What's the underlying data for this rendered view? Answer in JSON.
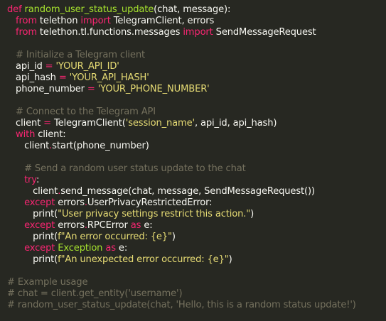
{
  "colors": {
    "background": "#272822",
    "default_text": "#f8f8f2",
    "keyword": "#f92672",
    "function_name": "#a6e22e",
    "string": "#e6db74",
    "comment": "#75715e"
  },
  "code": {
    "l1": {
      "kw": "def",
      "fn": "random_user_status_update",
      "rest": "(chat, message):"
    },
    "l2": {
      "kw1": "from",
      "mod": " telethon ",
      "kw2": "import",
      "rest": " TelegramClient, errors"
    },
    "l3": {
      "kw1": "from",
      "mod": " telethon.tl.functions.messages ",
      "kw2": "import",
      "rest": " SendMessageRequest"
    },
    "l5": {
      "comment": "# Initialize a Telegram client"
    },
    "l6": {
      "var": "api_id",
      "op": " = ",
      "str": "'YOUR_API_ID'"
    },
    "l7": {
      "var": "api_hash",
      "op": " = ",
      "str": "'YOUR_API_HASH'"
    },
    "l8": {
      "var": "phone_number",
      "op": " = ",
      "str": "'YOUR_PHONE_NUMBER'"
    },
    "l10": {
      "comment": "# Connect to the Telegram API"
    },
    "l11": {
      "var": "client",
      "op": " = ",
      "pre": "TelegramClient(",
      "str": "'session_name'",
      "rest": ", api_id, api_hash)"
    },
    "l12": {
      "kw": "with",
      "rest": " client:"
    },
    "l13": {
      "pre": "client",
      "op": ".",
      "rest": "start(phone_number)"
    },
    "l15": {
      "comment": "# Send a random user status update to the chat"
    },
    "l16": {
      "kw": "try",
      "rest": ":"
    },
    "l17": {
      "pre": "client",
      "op": ".",
      "rest": "send_message(chat, message, SendMessageRequest())"
    },
    "l18": {
      "kw": "except",
      "pre": " errors",
      "op": ".",
      "rest": "UserPrivacyRestrictedError:"
    },
    "l19": {
      "pre": "print(",
      "str": "\"User privacy settings restrict this action.\"",
      "rest": ")"
    },
    "l20": {
      "kw": "except",
      "pre": " errors",
      "op": ".",
      "mid": "RPCError ",
      "kw2": "as",
      "rest": " e:"
    },
    "l21": {
      "pre": "print(",
      "str": "f\"An error occurred: {e}\"",
      "rest": ")"
    },
    "l22": {
      "kw": "except",
      "ex": " Exception ",
      "kw2": "as",
      "rest": " e:"
    },
    "l23": {
      "pre": "print(",
      "str": "f\"An unexpected error occurred: {e}\"",
      "rest": ")"
    },
    "l25": {
      "comment": "# Example usage"
    },
    "l26": {
      "comment": "# chat = client.get_entity('username')"
    },
    "l27": {
      "comment": "# random_user_status_update(chat, 'Hello, this is a random status update!')"
    }
  }
}
